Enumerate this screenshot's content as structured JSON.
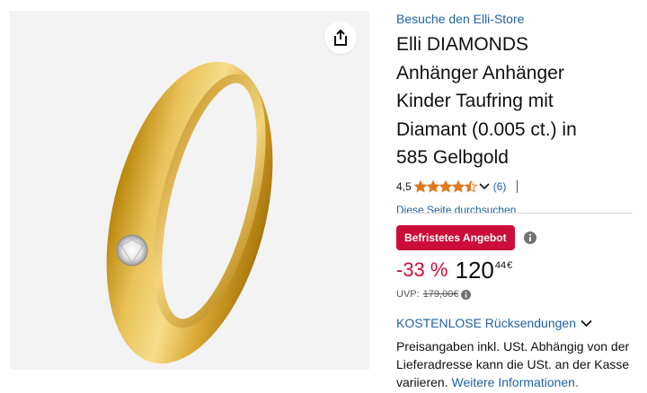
{
  "store_link": "Besuche den Elli-Store",
  "title_lines": [
    "Elli DIAMONDS",
    "Anhänger Anhänger",
    "Kinder Taufring mit",
    "Diamant (0.005 ct.) in",
    "585 Gelbgold"
  ],
  "rating": {
    "value_label": "4,5",
    "stars": 4.5,
    "max_stars": 5,
    "count_label": "(6)"
  },
  "search_link": "Diese Seite durchsuchen",
  "deal_badge": "Befristetes Angebot",
  "price": {
    "discount": "-33 %",
    "whole": "120",
    "fraction": "44",
    "currency": "€"
  },
  "uvp": {
    "label": "UVP:",
    "value": "179,00€"
  },
  "returns_link": "KOSTENLOSE Rücksendungen",
  "price_note": {
    "text": "Preisangaben inkl. USt. Abhängig von der Lieferadresse kann die USt. an der Kasse variieren.",
    "link": "Weitere Informationen."
  },
  "icons": {
    "share": "share-icon",
    "rating_dropdown": "chevron-down-icon",
    "deal_info": "info-icon",
    "uvp_info": "info-icon",
    "returns_dropdown": "chevron-down-icon"
  },
  "colors": {
    "link": "#2162a1",
    "deal": "#cc0c39",
    "star": "#de7921",
    "text": "#0f1111",
    "muted": "#565959"
  }
}
